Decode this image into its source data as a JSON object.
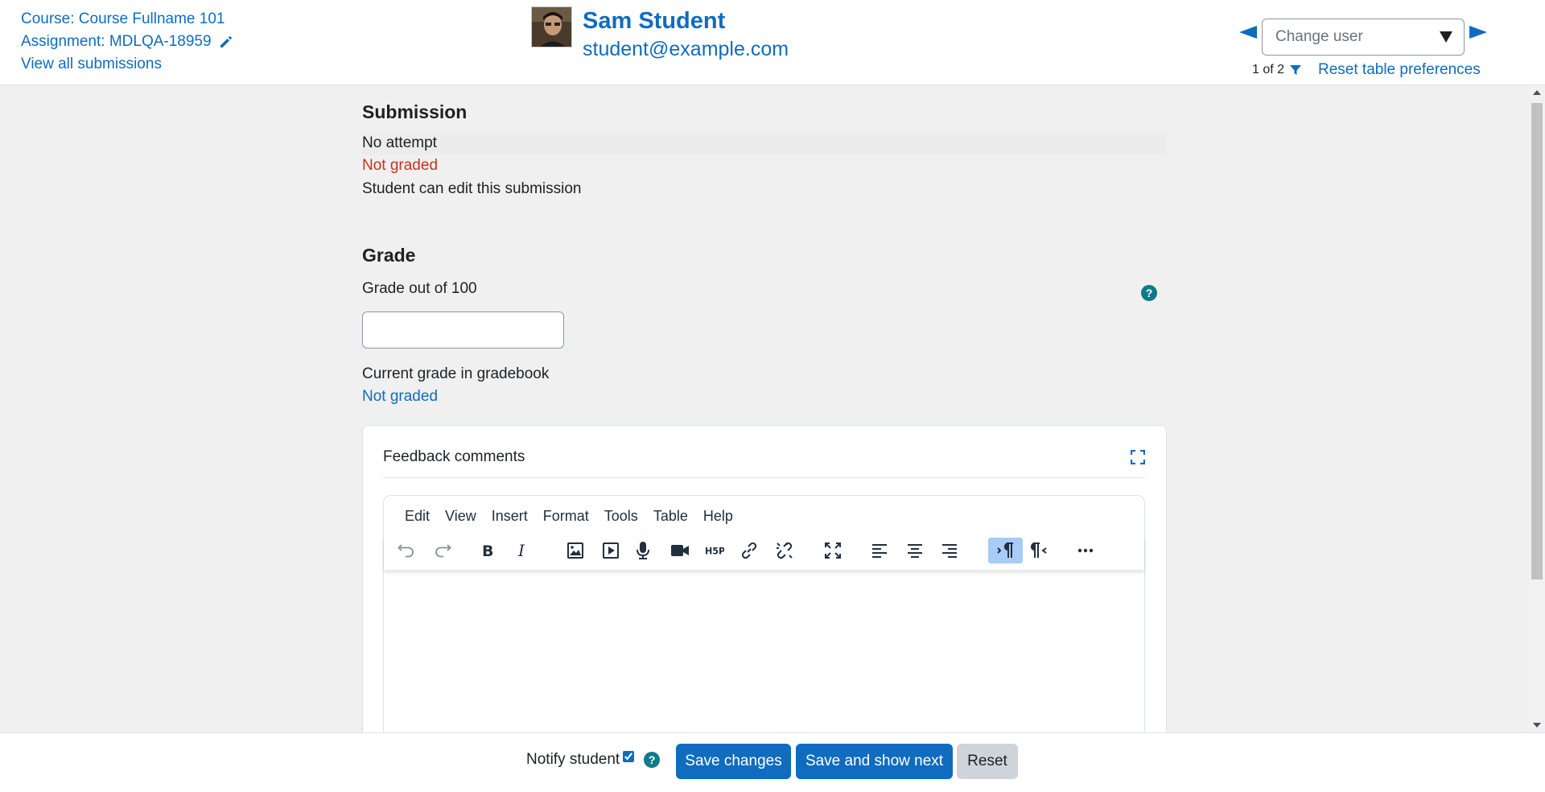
{
  "header": {
    "course_link": "Course: Course Fullname 101",
    "assignment_link": "Assignment: MDLQA-18959",
    "view_all": "View all submissions",
    "user_name": "Sam Student",
    "user_email": "student@example.com",
    "change_user_placeholder": "Change user",
    "pager": "1 of 2",
    "reset_prefs": "Reset table preferences"
  },
  "submission": {
    "title": "Submission",
    "attempt_status": "No attempt",
    "grading_status": "Not graded",
    "edit_status": "Student can edit this submission"
  },
  "grade": {
    "title": "Grade",
    "label": "Grade out of 100",
    "input_value": "",
    "current_label": "Current grade in gradebook",
    "current_value": "Not graded"
  },
  "feedback": {
    "title": "Feedback comments",
    "menu": [
      "Edit",
      "View",
      "Insert",
      "Format",
      "Tools",
      "Table",
      "Help"
    ]
  },
  "footer": {
    "notify_label": "Notify student",
    "notify_checked": true,
    "save_changes": "Save changes",
    "save_next": "Save and show next",
    "reset": "Reset"
  },
  "colors": {
    "accent": "#0f6cbf",
    "danger": "#ca3120",
    "help": "#0f7b8a"
  }
}
